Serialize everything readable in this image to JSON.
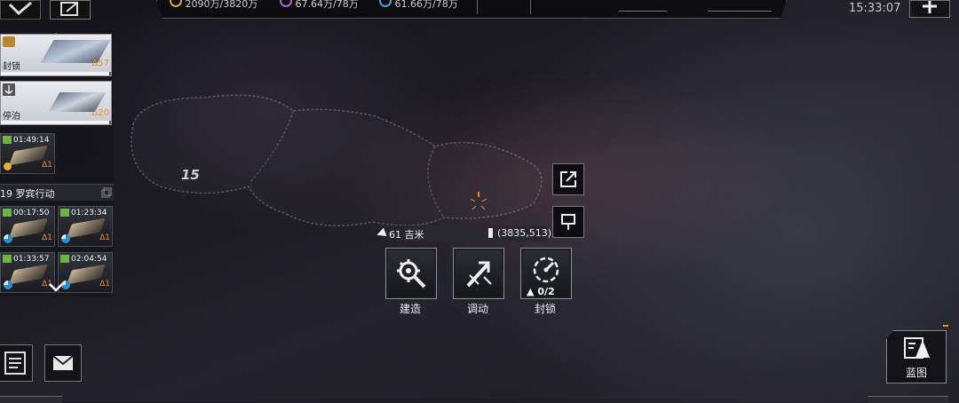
{
  "top_bar": {
    "resource_1": "2090万/3820万",
    "resource_2": "67.64万/78万",
    "resource_3": "61.66万/78万",
    "clock": "15:33:07"
  },
  "fleet_panel": {
    "blockade": {
      "label": "封锁",
      "count": "Δ57",
      "progress": 0.98
    },
    "docked": {
      "label": "停泊",
      "count": "Δ20",
      "progress": 0.98
    },
    "solo_timer": {
      "time": "01:49:14",
      "count": "Δ1"
    },
    "operation": {
      "title": "19 罗宾行动"
    },
    "timers": [
      {
        "time": "00:17:50",
        "count": "Δ1"
      },
      {
        "time": "01:23:34",
        "count": "Δ1"
      },
      {
        "time": "01:33:57",
        "count": "Δ1"
      },
      {
        "time": "02:04:54",
        "count": "Δ1"
      }
    ]
  },
  "map": {
    "region_number": "15",
    "distance": "61 吉米",
    "coordinates": "(3835,513)"
  },
  "actions": {
    "build": {
      "label": "建造"
    },
    "dispatch": {
      "label": "调动"
    },
    "blockade": {
      "label": "封锁",
      "counter": "0/2"
    }
  },
  "blueprint": {
    "label": "蓝图"
  },
  "icons": [
    "collapse-icon",
    "edit-icon",
    "plus-icon",
    "chevron-up-icon",
    "chevron-down-icon",
    "share-icon",
    "marker-icon",
    "wrench-gear-icon",
    "hammer-arrow-icon",
    "gauge-icon",
    "notes-icon",
    "mail-icon",
    "blueprint-icon"
  ],
  "colors": {
    "accent_orange": "#f0883a",
    "timer_green": "#6db33f",
    "panel_white": "#e9eaee"
  }
}
